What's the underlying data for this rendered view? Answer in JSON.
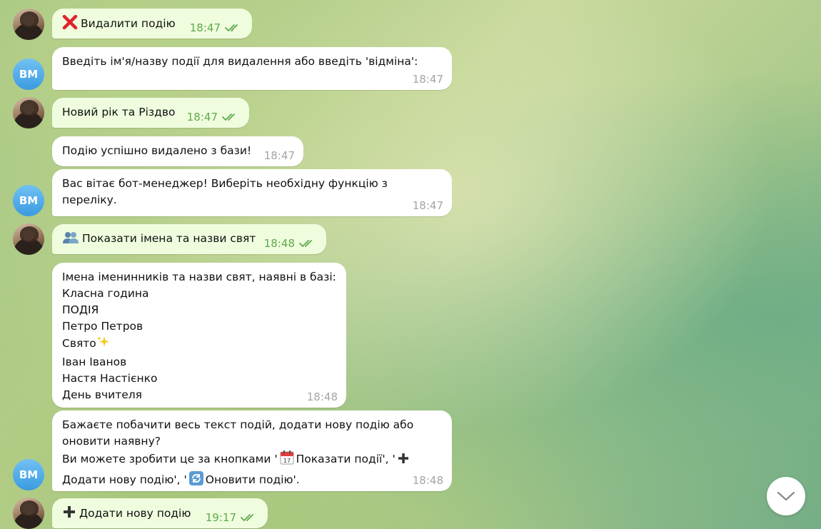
{
  "avatar": {
    "bot_initials": "BM"
  },
  "messages": [
    {
      "text": "Видалити подію",
      "time": "18:47",
      "icon": "cross-mark-icon"
    },
    {
      "text": "Введіть ім'я/назву події для видалення або введіть 'відміна':",
      "time": "18:47"
    },
    {
      "text": "Новий рік та Різдво",
      "time": "18:47"
    },
    {
      "text": "Подію успішно видалено з бази!",
      "time": "18:47"
    },
    {
      "lines": [
        "Вас вітає бот-менеджер! Виберіть необхідну функцію з",
        "переліку."
      ],
      "time": "18:47"
    },
    {
      "text": "Показати імена та назви свят",
      "time": "18:48",
      "icon": "people-icon"
    },
    {
      "lines": [
        "Імена іменинників та назви свят, наявні в базі:",
        "Класна година",
        "ПОДІЯ",
        "Петро Петров",
        "Свято",
        "Іван Іванов",
        "Настя Настієнко",
        "День вчителя"
      ],
      "time": "18:48",
      "icon": "sparkles-icon"
    },
    {
      "lines": [
        "Бажаєте побачити весь текст подій, додати нову подію або",
        "оновити наявну?",
        "Ви можете зробити це за кнопками '",
        "Показати події', '",
        "Додати нову подію', '",
        "Оновити подію'."
      ],
      "time": "18:48"
    },
    {
      "text": "Додати нову подію",
      "time": "19:17",
      "icon": "plus-icon"
    }
  ],
  "colors": {
    "outgoing_bubble": "#effdde",
    "incoming_bubble": "#ffffff",
    "outgoing_time": "#5ea94c",
    "incoming_time": "#a4a4a4",
    "bot_avatar": "#3a9be0"
  }
}
